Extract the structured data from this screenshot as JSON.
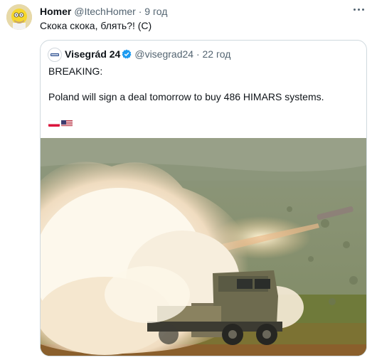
{
  "tweet": {
    "author_name": "Homer",
    "author_handle": "@ItechHomer",
    "separator": "·",
    "time": "9 год",
    "text": "Скока скока, блять?! (С)"
  },
  "quoted_tweet": {
    "author_name": "Visegrád 24",
    "author_handle": "@visegrad24",
    "separator": "·",
    "time": "22 год",
    "line1": "BREAKING:",
    "line2": "Poland will sign a deal tomorrow to buy 486 HIMARS systems.",
    "flags": [
      "poland-flag-icon",
      "usa-flag-icon"
    ],
    "media_alt": "HIMARS launcher firing a rocket"
  },
  "colors": {
    "text": "#0f1419",
    "secondary": "#536471",
    "border": "#cfd9de",
    "verified": "#1d9bf0"
  },
  "icons": [
    "verified-badge-icon",
    "more-icon"
  ]
}
